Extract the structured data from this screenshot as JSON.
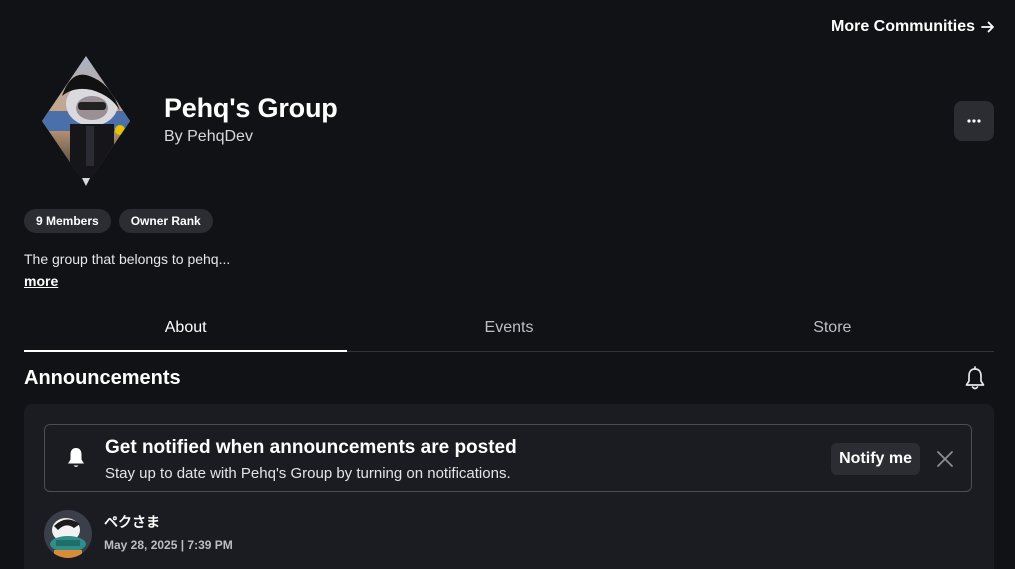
{
  "header": {
    "more_communities_label": "More Communities",
    "arrow_icon": "arrow-right-icon"
  },
  "group": {
    "name": "Pehq's Group",
    "by_prefix": "By",
    "owner": "PehqDev",
    "emblem_icon": "group-emblem",
    "more_options_icon": "ellipsis-icon"
  },
  "chips": [
    {
      "label": "9 Members"
    },
    {
      "label": "Owner Rank"
    }
  ],
  "description": {
    "text": "The group that belongs to pehq...",
    "more_label": "more"
  },
  "tabs": [
    {
      "label": "About",
      "active": true
    },
    {
      "label": "Events",
      "active": false
    },
    {
      "label": "Store",
      "active": false
    }
  ],
  "announcements": {
    "title": "Announcements",
    "bell_icon": "bell-outline-icon",
    "notify_card": {
      "icon": "bell-icon",
      "title": "Get notified when announcements are posted",
      "subtitle": "Stay up to date with Pehq's Group by turning on notifications.",
      "button_label": "Notify me",
      "dismiss_icon": "close-icon"
    },
    "post": {
      "author": "ペクさま",
      "date": "May 28, 2025 | 7:39 PM"
    }
  },
  "colors": {
    "background": "#111216",
    "surface": "#1b1c21",
    "chip": "#2b2d33",
    "text_primary": "#ffffff",
    "text_secondary": "#bcbec4"
  }
}
